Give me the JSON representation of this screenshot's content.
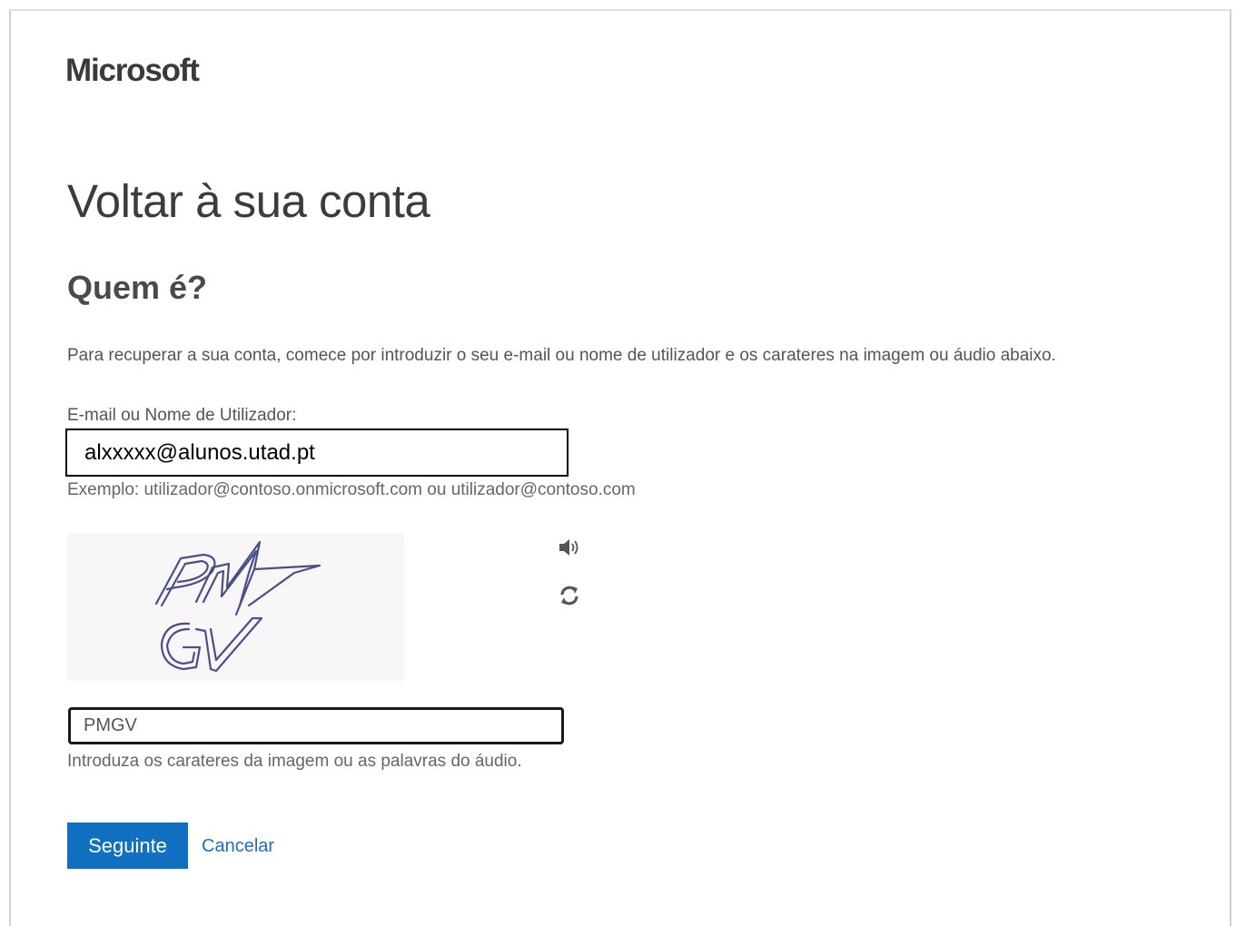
{
  "brand": {
    "logo_text": "Microsoft"
  },
  "page": {
    "title": "Voltar à sua conta",
    "subtitle": "Quem é?",
    "intro": "Para recuperar a sua conta, comece por introduzir o seu e-mail ou nome de utilizador e os carateres na imagem ou áudio abaixo."
  },
  "email": {
    "label": "E-mail ou Nome de Utilizador:",
    "value": "alxxxxx@alunos.utad.pt",
    "example": "Exemplo: utilizador@contoso.onmicrosoft.com ou utilizador@contoso.com"
  },
  "captcha": {
    "image_text": "PMGV",
    "audio_icon": "speaker-icon",
    "refresh_icon": "refresh-icon",
    "input_value": "PMGV",
    "hint": "Introduza os carateres da imagem ou as palavras do áudio."
  },
  "actions": {
    "next_label": "Seguinte",
    "cancel_label": "Cancelar"
  },
  "colors": {
    "primary_button": "#1170c2",
    "link": "#1f6fb8",
    "captcha_ink": "#4a4f8a"
  }
}
